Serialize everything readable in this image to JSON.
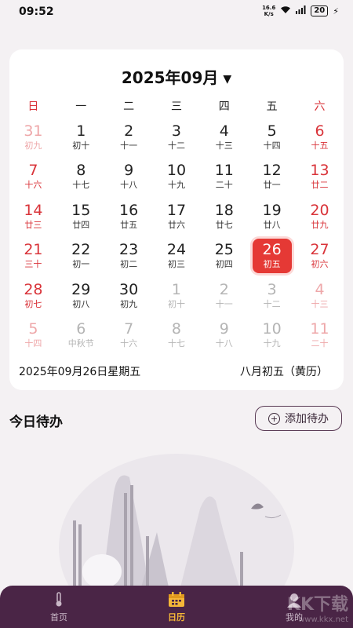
{
  "status": {
    "time": "09:52",
    "speed_top": "16.6",
    "speed_bottom": "K/s",
    "battery": "20"
  },
  "calendar": {
    "month_title": "2025年09月",
    "weekdays": [
      "日",
      "一",
      "二",
      "三",
      "四",
      "五",
      "六"
    ],
    "weeks": [
      [
        {
          "d": "31",
          "l": "初九",
          "o": true
        },
        {
          "d": "1",
          "l": "初十"
        },
        {
          "d": "2",
          "l": "十一"
        },
        {
          "d": "3",
          "l": "十二"
        },
        {
          "d": "4",
          "l": "十三"
        },
        {
          "d": "5",
          "l": "十四"
        },
        {
          "d": "6",
          "l": "十五"
        }
      ],
      [
        {
          "d": "7",
          "l": "十六"
        },
        {
          "d": "8",
          "l": "十七"
        },
        {
          "d": "9",
          "l": "十八"
        },
        {
          "d": "10",
          "l": "十九"
        },
        {
          "d": "11",
          "l": "二十"
        },
        {
          "d": "12",
          "l": "廿一"
        },
        {
          "d": "13",
          "l": "廿二"
        }
      ],
      [
        {
          "d": "14",
          "l": "廿三"
        },
        {
          "d": "15",
          "l": "廿四"
        },
        {
          "d": "16",
          "l": "廿五"
        },
        {
          "d": "17",
          "l": "廿六"
        },
        {
          "d": "18",
          "l": "廿七"
        },
        {
          "d": "19",
          "l": "廿八"
        },
        {
          "d": "20",
          "l": "廿九"
        }
      ],
      [
        {
          "d": "21",
          "l": "三十"
        },
        {
          "d": "22",
          "l": "初一"
        },
        {
          "d": "23",
          "l": "初二"
        },
        {
          "d": "24",
          "l": "初三"
        },
        {
          "d": "25",
          "l": "初四"
        },
        {
          "d": "26",
          "l": "初五",
          "s": true
        },
        {
          "d": "27",
          "l": "初六"
        }
      ],
      [
        {
          "d": "28",
          "l": "初七"
        },
        {
          "d": "29",
          "l": "初八"
        },
        {
          "d": "30",
          "l": "初九"
        },
        {
          "d": "1",
          "l": "初十",
          "o": true
        },
        {
          "d": "2",
          "l": "十一",
          "o": true
        },
        {
          "d": "3",
          "l": "十二",
          "o": true
        },
        {
          "d": "4",
          "l": "十三",
          "o": true
        }
      ],
      [
        {
          "d": "5",
          "l": "十四",
          "o": true
        },
        {
          "d": "6",
          "l": "中秋节",
          "o": true
        },
        {
          "d": "7",
          "l": "十六",
          "o": true
        },
        {
          "d": "8",
          "l": "十七",
          "o": true
        },
        {
          "d": "9",
          "l": "十八",
          "o": true
        },
        {
          "d": "10",
          "l": "十九",
          "o": true
        },
        {
          "d": "11",
          "l": "二十",
          "o": true
        }
      ]
    ],
    "selected_date": "2025年09月26日星期五",
    "selected_lunar": "八月初五（黄历）"
  },
  "todo": {
    "title": "今日待办",
    "add_label": "添加待办"
  },
  "nav": {
    "home": "首页",
    "calendar": "日历",
    "mine": "我的"
  },
  "watermark": {
    "main": "KK下载",
    "sub": "www.kkx.net"
  },
  "colors": {
    "accent": "#e53935",
    "nav_bg": "#4a2546",
    "nav_active": "#f5b738"
  }
}
